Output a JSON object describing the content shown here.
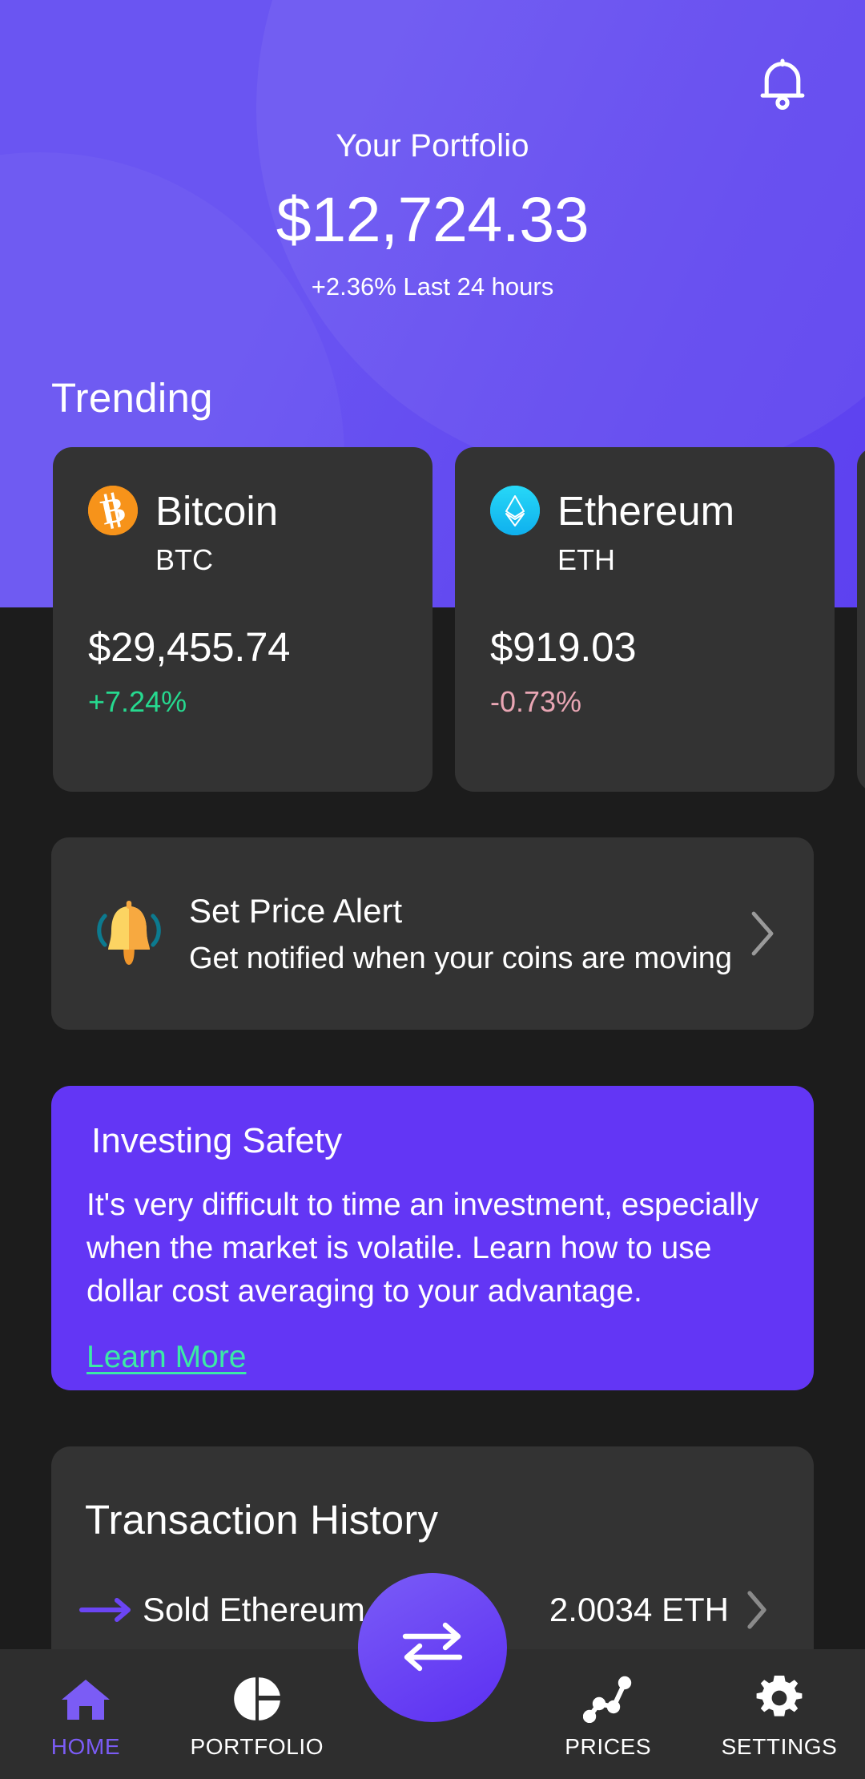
{
  "header": {
    "bell_icon": "bell-icon",
    "portfolio_label": "Your Portfolio",
    "portfolio_value": "$12,724.33",
    "portfolio_change": "+2.36% Last 24 hours",
    "gradient_start": "#6a55f2",
    "gradient_end": "#5d41f0"
  },
  "trending": {
    "title": "Trending",
    "coins": [
      {
        "name": "Bitcoin",
        "symbol": "BTC",
        "price": "$29,455.74",
        "change": "+7.24%",
        "change_color": "#26d98f",
        "icon": "bitcoin-icon",
        "icon_color": "#f7931a"
      },
      {
        "name": "Ethereum",
        "symbol": "ETH",
        "price": "$919.03",
        "change": "-0.73%",
        "change_color": "#e9a6b4",
        "icon": "ethereum-icon",
        "icon_color": "#18c5f2"
      }
    ]
  },
  "price_alert": {
    "icon": "ringing-bell-icon",
    "title": "Set Price Alert",
    "subtitle": "Get notified when your coins are moving",
    "chevron": "chevron-right-icon"
  },
  "investing_safety": {
    "title": "Investing Safety",
    "body": "It's very difficult to time an investment, especially when the market is volatile. Learn how to use dollar cost averaging to your advantage.",
    "link_label": "Learn More",
    "link_color": "#3ce9a6",
    "card_color": "#6336f5"
  },
  "transaction_history": {
    "title": "Transaction History",
    "rows": [
      {
        "icon": "arrow-right-icon",
        "label": "Sold Ethereum",
        "amount": "2.0034 ETH",
        "chevron": "chevron-right-icon"
      }
    ]
  },
  "fab": {
    "icon": "swap-arrows-icon",
    "color": "#6b45f4"
  },
  "bottom_nav": {
    "active_color": "#7b5cf5",
    "items": [
      {
        "label": "HOME",
        "icon": "home-icon",
        "active": true
      },
      {
        "label": "PORTFOLIO",
        "icon": "pie-chart-icon",
        "active": false
      },
      {
        "label": "PRICES",
        "icon": "line-chart-icon",
        "active": false
      },
      {
        "label": "SETTINGS",
        "icon": "gear-icon",
        "active": false
      }
    ]
  }
}
